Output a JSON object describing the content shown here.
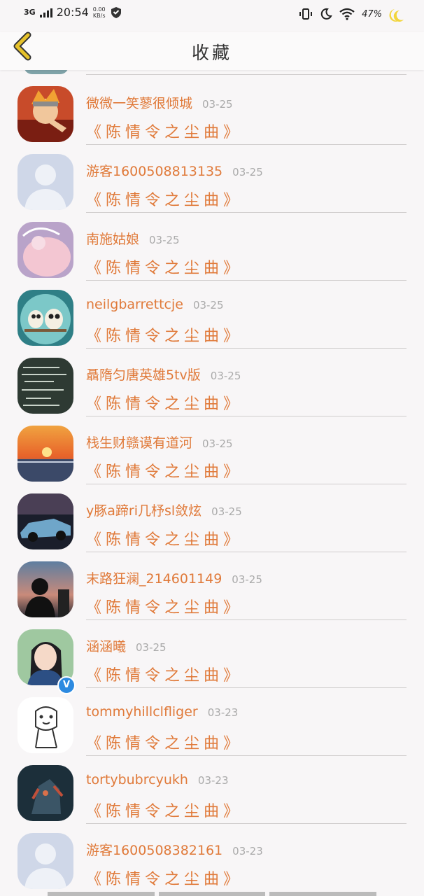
{
  "status_bar": {
    "network": "3G",
    "time": "20:54",
    "speed_value": "0.00",
    "speed_unit": "KB/s",
    "battery": "47%"
  },
  "header": {
    "title": "收藏",
    "back_icon": "chevron-left-icon"
  },
  "items": [
    {
      "name": "微微一笑蓼很倾城",
      "date": "03-25",
      "song": "《陈情令之尘曲》",
      "avatar": "anime-avatar"
    },
    {
      "name": "游客1600508813135",
      "date": "03-25",
      "song": "《陈情令之尘曲》",
      "avatar": "default-avatar"
    },
    {
      "name": "南施姑娘",
      "date": "03-25",
      "song": "《陈情令之尘曲》",
      "avatar": "pink-girl-avatar"
    },
    {
      "name": "neilgbarrettcje",
      "date": "03-25",
      "song": "《陈情令之尘曲》",
      "avatar": "owl-avatar"
    },
    {
      "name": "聶隋匀唐英雄5tv版",
      "date": "03-25",
      "song": "《陈情令之尘曲》",
      "avatar": "chalkboard-avatar"
    },
    {
      "name": "栈生财赣谟有道河",
      "date": "03-25",
      "song": "《陈情令之尘曲》",
      "avatar": "sunset-avatar"
    },
    {
      "name": "y豚a蹄ri几杼sl敛炫",
      "date": "03-25",
      "song": "《陈情令之尘曲》",
      "avatar": "car-avatar"
    },
    {
      "name": "末路狂澜_214601149",
      "date": "03-25",
      "song": "《陈情令之尘曲》",
      "avatar": "silhouette-avatar"
    },
    {
      "name": "涵涵曦",
      "date": "03-25",
      "song": "《陈情令之尘曲》",
      "avatar": "girl-photo-avatar",
      "verified": "V"
    },
    {
      "name": "tommyhillclfliger",
      "date": "03-23",
      "song": "《陈情令之尘曲》",
      "avatar": "tiger-sketch-avatar"
    },
    {
      "name": "tortybubrcyukh",
      "date": "03-23",
      "song": "《陈情令之尘曲》",
      "avatar": "game-hero-avatar"
    },
    {
      "name": "游客1600508382161",
      "date": "03-23",
      "song": "《陈情令之尘曲》",
      "avatar": "default-avatar"
    }
  ],
  "colors": {
    "accent": "#e07a3a",
    "back_icon": "#e6c22b",
    "date": "#aaaaaa",
    "divider": "#d0cdcd"
  }
}
